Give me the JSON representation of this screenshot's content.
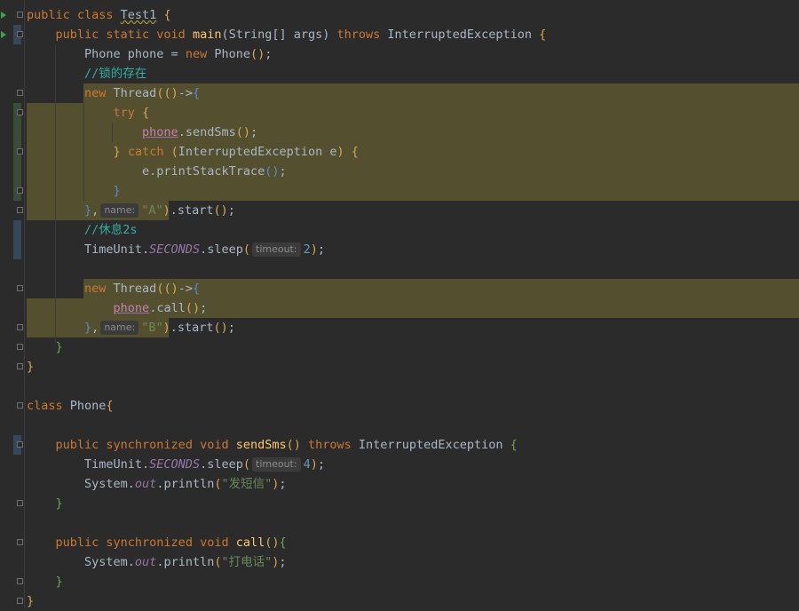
{
  "editor": {
    "lines": [
      [
        {
          "c": "kw",
          "t": "public class "
        },
        {
          "c": "wavy",
          "t": "Test1"
        },
        {
          "c": "brace-y",
          "t": " {"
        }
      ],
      [
        {
          "t": "    "
        },
        {
          "c": "kw",
          "t": "public static void "
        },
        {
          "c": "fn",
          "t": "main"
        },
        {
          "t": "(String[] args) "
        },
        {
          "c": "kw",
          "t": "throws "
        },
        {
          "t": "InterruptedException "
        },
        {
          "c": "brace-y",
          "t": "{"
        }
      ],
      [
        {
          "t": "        Phone phone = "
        },
        {
          "c": "kw",
          "t": "new "
        },
        {
          "t": "Phone"
        },
        {
          "c": "brace-y",
          "t": "()"
        },
        {
          "t": ";"
        }
      ],
      [
        {
          "t": "        "
        },
        {
          "c": "cmt",
          "t": "//锁的存在"
        }
      ],
      [
        {
          "t": "        "
        },
        {
          "c": "kw",
          "t": "new "
        },
        {
          "t": "Thread"
        },
        {
          "c": "brace-y",
          "t": "(()"
        },
        {
          "t": "->"
        },
        {
          "c": "brace-b",
          "t": "{"
        }
      ],
      [
        {
          "t": "            "
        },
        {
          "c": "kw",
          "t": "try "
        },
        {
          "c": "brace-y",
          "t": "{"
        }
      ],
      [
        {
          "t": "                "
        },
        {
          "c": "ul",
          "t": "phone"
        },
        {
          "t": ".sendSms"
        },
        {
          "c": "brace-y",
          "t": "()"
        },
        {
          "t": ";"
        }
      ],
      [
        {
          "t": "            "
        },
        {
          "c": "brace-y",
          "t": "} "
        },
        {
          "c": "kw",
          "t": "catch "
        },
        {
          "c": "brace-y",
          "t": "("
        },
        {
          "t": "InterruptedException e"
        },
        {
          "c": "brace-y",
          "t": ") {"
        }
      ],
      [
        {
          "t": "                e.printStackTrace"
        },
        {
          "c": "brace-b",
          "t": "()"
        },
        {
          "t": ";"
        }
      ],
      [
        {
          "t": "            "
        },
        {
          "c": "brace-b",
          "t": "}"
        }
      ],
      [
        {
          "t": "        "
        },
        {
          "c": "brace-b",
          "t": "}"
        },
        {
          "t": ","
        },
        {
          "hint": "name:"
        },
        {
          "c": "str",
          "t": "\"A\""
        },
        {
          "c": "brace-y",
          "t": ")"
        },
        {
          "t": ".start"
        },
        {
          "c": "brace-y",
          "t": "()"
        },
        {
          "t": ";"
        }
      ],
      [
        {
          "t": "        "
        },
        {
          "c": "cmt",
          "t": "//休息2s"
        }
      ],
      [
        {
          "t": "        TimeUnit."
        },
        {
          "c": "field",
          "t": "SECONDS"
        },
        {
          "t": ".sleep"
        },
        {
          "c": "brace-y",
          "t": "("
        },
        {
          "hint": "timeout:"
        },
        {
          "c": "num",
          "t": "2"
        },
        {
          "c": "brace-y",
          "t": ")"
        },
        {
          "t": ";"
        }
      ],
      [
        {
          "t": ""
        }
      ],
      [
        {
          "t": "        "
        },
        {
          "c": "kw",
          "t": "new "
        },
        {
          "t": "Thread"
        },
        {
          "c": "brace-y",
          "t": "(()"
        },
        {
          "t": "->"
        },
        {
          "c": "brace-b",
          "t": "{"
        }
      ],
      [
        {
          "t": "            "
        },
        {
          "c": "ul",
          "t": "phone"
        },
        {
          "t": ".call"
        },
        {
          "c": "brace-y",
          "t": "()"
        },
        {
          "t": ";"
        }
      ],
      [
        {
          "t": "        "
        },
        {
          "c": "brace-b",
          "t": "}"
        },
        {
          "t": ","
        },
        {
          "hint": "name:"
        },
        {
          "c": "str",
          "t": "\"B\""
        },
        {
          "c": "brace-y",
          "t": ")"
        },
        {
          "t": ".start"
        },
        {
          "c": "brace-y",
          "t": "()"
        },
        {
          "t": ";"
        }
      ],
      [
        {
          "t": "    "
        },
        {
          "c": "brace-g",
          "t": "}"
        }
      ],
      [
        {
          "c": "brace-y",
          "t": "}"
        }
      ],
      [
        {
          "t": ""
        }
      ],
      [
        {
          "c": "kw",
          "t": "class "
        },
        {
          "t": "Phone"
        },
        {
          "c": "brace-y",
          "t": "{"
        }
      ],
      [
        {
          "t": ""
        }
      ],
      [
        {
          "t": "    "
        },
        {
          "c": "kw",
          "t": "public synchronized void "
        },
        {
          "c": "fn",
          "t": "sendSms"
        },
        {
          "c": "brace-y",
          "t": "() "
        },
        {
          "c": "kw",
          "t": "throws "
        },
        {
          "t": "InterruptedException "
        },
        {
          "c": "brace-g",
          "t": "{"
        }
      ],
      [
        {
          "t": "        TimeUnit."
        },
        {
          "c": "field",
          "t": "SECONDS"
        },
        {
          "t": ".sleep"
        },
        {
          "c": "brace-y",
          "t": "("
        },
        {
          "hint": "timeout:"
        },
        {
          "c": "num",
          "t": "4"
        },
        {
          "c": "brace-y",
          "t": ")"
        },
        {
          "t": ";"
        }
      ],
      [
        {
          "t": "        System."
        },
        {
          "c": "field",
          "t": "out"
        },
        {
          "t": ".println"
        },
        {
          "c": "brace-y",
          "t": "("
        },
        {
          "c": "str",
          "t": "\"发短信\""
        },
        {
          "c": "brace-y",
          "t": ")"
        },
        {
          "t": ";"
        }
      ],
      [
        {
          "t": "    "
        },
        {
          "c": "brace-g",
          "t": "}"
        }
      ],
      [
        {
          "t": ""
        }
      ],
      [
        {
          "t": "    "
        },
        {
          "c": "kw",
          "t": "public synchronized void "
        },
        {
          "c": "fn",
          "t": "call"
        },
        {
          "c": "brace-y",
          "t": "()"
        },
        {
          "c": "brace-g",
          "t": "{"
        }
      ],
      [
        {
          "t": "        System."
        },
        {
          "c": "field",
          "t": "out"
        },
        {
          "t": ".println"
        },
        {
          "c": "brace-y",
          "t": "("
        },
        {
          "c": "str",
          "t": "\"打电话\""
        },
        {
          "c": "brace-y",
          "t": ")"
        },
        {
          "t": ";"
        }
      ],
      [
        {
          "t": "    "
        },
        {
          "c": "brace-g",
          "t": "}"
        }
      ],
      [
        {
          "c": "brace-y",
          "t": "}"
        }
      ]
    ]
  },
  "gutter": {
    "run_icon": "run-triangle-icon",
    "fold_icon": "fold-marker-icon"
  },
  "colors": {
    "background": "#2b2b2b",
    "keyword": "#cc7832",
    "method": "#ffc66d",
    "string": "#6a8759",
    "number": "#6897bb",
    "comment": "#2fb0a0",
    "highlight": "#54502f"
  }
}
